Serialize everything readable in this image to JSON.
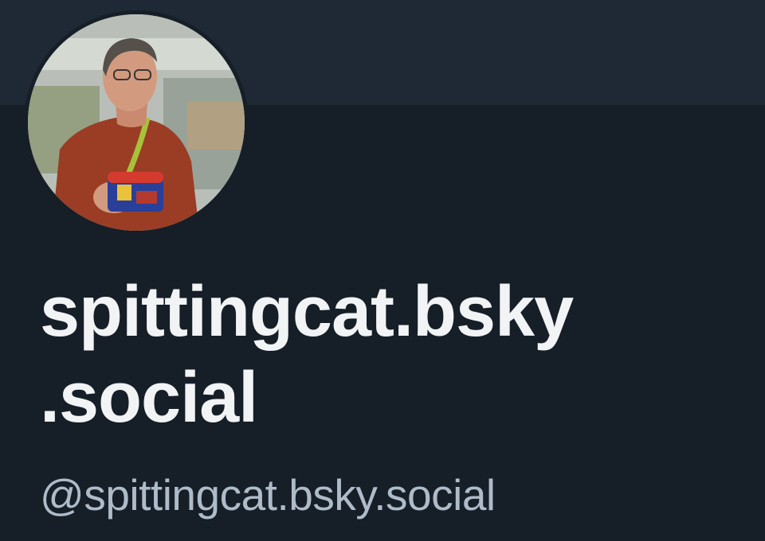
{
  "profile": {
    "display_name_line1": "spittingcat.bsky",
    "display_name_line2": ".social",
    "handle": "@spittingcat.bsky.social"
  },
  "colors": {
    "background": "#161e27",
    "banner": "#1f2935",
    "display_name": "#f1f3f5",
    "handle": "#aebbc9"
  }
}
